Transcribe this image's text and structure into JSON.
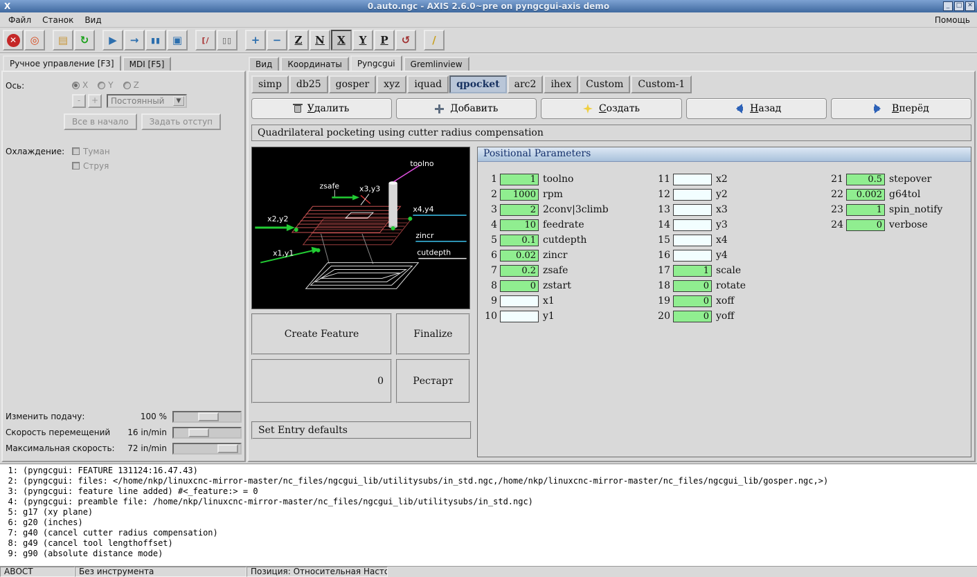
{
  "window": {
    "title": "0.auto.ngc - AXIS 2.6.0~pre on pyngcgui-axis demo",
    "logo_glyph": "X",
    "controls": [
      {
        "id": "minimize",
        "glyph": "_"
      },
      {
        "id": "maximize",
        "glyph": "□"
      },
      {
        "id": "close",
        "glyph": "✕"
      }
    ]
  },
  "menubar": {
    "items": [
      {
        "id": "file",
        "label": "Файл"
      },
      {
        "id": "machine",
        "label": "Станок"
      },
      {
        "id": "view",
        "label": "Вид"
      }
    ],
    "help": "Помощь"
  },
  "toolbar": {
    "icons": [
      {
        "id": "estop",
        "glyph": "✕",
        "color": "#ffffff",
        "circle": "#c42727"
      },
      {
        "id": "machine-power",
        "glyph": "◎",
        "color": "#d84a1e"
      },
      {
        "sep": true
      },
      {
        "id": "open-file",
        "glyph": "▤",
        "color": "#c8973a"
      },
      {
        "id": "reload-file",
        "glyph": "↻",
        "color": "#18a018"
      },
      {
        "sep": true
      },
      {
        "id": "run-program",
        "glyph": "▶",
        "color": "#2d6fae"
      },
      {
        "id": "step-line",
        "glyph": "→",
        "color": "#2d6fae"
      },
      {
        "id": "pause-program",
        "glyph": "▮▮",
        "color": "#2d6fae",
        "small": true
      },
      {
        "id": "stop-program",
        "glyph": "▣",
        "color": "#2d6fae"
      },
      {
        "sep": true
      },
      {
        "id": "skip-lines",
        "glyph": "[/",
        "color": "#a83232",
        "small": true
      },
      {
        "id": "optional-pause",
        "glyph": "▯▯",
        "color": "#555555",
        "small": true
      },
      {
        "sep": true
      },
      {
        "id": "zoom-in",
        "glyph": "+",
        "color": "#2d6fae"
      },
      {
        "id": "zoom-out",
        "glyph": "−",
        "color": "#2d6fae"
      },
      {
        "id": "view-top",
        "glyph": "Z",
        "color": "#1a1a1a",
        "underline": true
      },
      {
        "id": "view-top-rotated",
        "glyph": "N",
        "color": "#1a1a1a",
        "underline": true
      },
      {
        "id": "view-side",
        "glyph": "X",
        "color": "#1a1a1a",
        "underline": true,
        "pressed": true
      },
      {
        "id": "view-front",
        "glyph": "Y",
        "color": "#1a1a1a",
        "underline": true
      },
      {
        "id": "view-perspective",
        "glyph": "P",
        "color": "#1a1a1a",
        "underline": true
      },
      {
        "id": "rotate-view",
        "glyph": "↺",
        "color": "#a03030"
      },
      {
        "sep": true
      },
      {
        "id": "clear-plot",
        "glyph": "/",
        "color": "#c8a020"
      }
    ]
  },
  "left_panel": {
    "tabs": [
      {
        "id": "manual",
        "label": "Ручное управление [F3]",
        "active": true
      },
      {
        "id": "mdi",
        "label": "MDI [F5]",
        "active": false
      }
    ],
    "axis_label": "Ось:",
    "axis_options": [
      {
        "id": "x",
        "label": "X",
        "selected": true
      },
      {
        "id": "y",
        "label": "Y",
        "selected": false
      },
      {
        "id": "z",
        "label": "Z",
        "selected": false
      }
    ],
    "jog_minus": "-",
    "jog_plus": "+",
    "jog_mode": "Постоянный",
    "combo_arrow": "▼",
    "home_all": "Все в начало",
    "set_offset": "Задать отступ",
    "coolant_label": "Охлаждение:",
    "coolant_options": [
      {
        "id": "mist",
        "label": "Туман"
      },
      {
        "id": "flood",
        "label": "Струя"
      }
    ],
    "sliders": [
      {
        "id": "feed-override",
        "label": "Изменить подачу:",
        "value": "100 %",
        "pos": 36
      },
      {
        "id": "jog-speed",
        "label": "Скорость перемещений",
        "value": "16 in/min",
        "pos": 22
      },
      {
        "id": "max-velocity",
        "label": "Максимальная скорость:",
        "value": "72 in/min",
        "pos": 66
      }
    ]
  },
  "right_panel": {
    "tabs": [
      {
        "id": "preview",
        "label": "Вид",
        "active": false
      },
      {
        "id": "dro",
        "label": "Координаты",
        "active": false
      },
      {
        "id": "pyngcgui",
        "label": "Pyngcgui",
        "active": true
      },
      {
        "id": "gremlinview",
        "label": "Gremlinview",
        "active": false
      }
    ],
    "subtabs": [
      {
        "label": "simp"
      },
      {
        "label": "db25"
      },
      {
        "label": "gosper"
      },
      {
        "label": "xyz"
      },
      {
        "label": "iquad"
      },
      {
        "label": "qpocket",
        "active": true
      },
      {
        "label": "arc2"
      },
      {
        "label": "ihex"
      },
      {
        "label": "Custom"
      },
      {
        "label": "Custom-1"
      }
    ],
    "actions": [
      {
        "id": "delete",
        "label": "Удалить",
        "icon": "trash"
      },
      {
        "id": "add",
        "label": "Добавить",
        "icon": "plus"
      },
      {
        "id": "create",
        "label": "Создать",
        "icon": "new"
      },
      {
        "id": "back",
        "label": "Назад",
        "icon": "arrow-left"
      },
      {
        "id": "forward",
        "label": "Вперёд",
        "icon": "arrow-right"
      }
    ],
    "description": "Quadrilateral pocketing using cutter radius compensation",
    "preview": {
      "labels": {
        "toolno": "toolno",
        "zsafe": "zsafe",
        "x3y3": "x3,y3",
        "x4y4": "x4,y4",
        "x2y2": "x2,y2",
        "zincr": "zincr",
        "x1y1": "x1,y1",
        "cutdepth": "cutdepth"
      }
    },
    "feature_buttons": {
      "create": "Create Feature",
      "finalize": "Finalize",
      "count": "0",
      "restart": "Рестарт",
      "set_defaults": "Set Entry defaults"
    },
    "params": {
      "title": "Positional Parameters",
      "items": [
        {
          "num": "1",
          "value": "1",
          "label": "toolno",
          "filled": true
        },
        {
          "num": "2",
          "value": "1000",
          "label": "rpm",
          "filled": true
        },
        {
          "num": "3",
          "value": "2",
          "label": "2conv|3climb",
          "filled": true
        },
        {
          "num": "4",
          "value": "10",
          "label": "feedrate",
          "filled": true
        },
        {
          "num": "5",
          "value": "0.1",
          "label": "cutdepth",
          "filled": true
        },
        {
          "num": "6",
          "value": "0.02",
          "label": "zincr",
          "filled": true
        },
        {
          "num": "7",
          "value": "0.2",
          "label": "zsafe",
          "filled": true
        },
        {
          "num": "8",
          "value": "0",
          "label": "zstart",
          "filled": true
        },
        {
          "num": "9",
          "value": "",
          "label": "x1",
          "filled": false
        },
        {
          "num": "10",
          "value": "",
          "label": "y1",
          "filled": false
        },
        {
          "num": "11",
          "value": "",
          "label": "x2",
          "filled": false
        },
        {
          "num": "12",
          "value": "",
          "label": "y2",
          "filled": false
        },
        {
          "num": "13",
          "value": "",
          "label": "x3",
          "filled": false
        },
        {
          "num": "14",
          "value": "",
          "label": "y3",
          "filled": false
        },
        {
          "num": "15",
          "value": "",
          "label": "x4",
          "filled": false
        },
        {
          "num": "16",
          "value": "",
          "label": "y4",
          "filled": false
        },
        {
          "num": "17",
          "value": "1",
          "label": "scale",
          "filled": true
        },
        {
          "num": "18",
          "value": "0",
          "label": "rotate",
          "filled": true
        },
        {
          "num": "19",
          "value": "0",
          "label": "xoff",
          "filled": true
        },
        {
          "num": "20",
          "value": "0",
          "label": "yoff",
          "filled": true
        },
        {
          "num": "21",
          "value": "0.5",
          "label": "stepover",
          "filled": true
        },
        {
          "num": "22",
          "value": "0.002",
          "label": "g64tol",
          "filled": true
        },
        {
          "num": "23",
          "value": "1",
          "label": "spin_notify",
          "filled": true
        },
        {
          "num": "24",
          "value": "0",
          "label": "verbose",
          "filled": true
        }
      ]
    }
  },
  "terminal": {
    "lines": [
      {
        "num": "1:",
        "text": "(pyngcgui: FEATURE 131124:16.47.43)"
      },
      {
        "num": "2:",
        "text": "(pyngcgui: files: </home/nkp/linuxcnc-mirror-master/nc_files/ngcgui_lib/utilitysubs/in_std.ngc,/home/nkp/linuxcnc-mirror-master/nc_files/ngcgui_lib/gosper.ngc,>)"
      },
      {
        "num": "3:",
        "text": "(pyngcgui: feature line added) #<_feature:> = 0"
      },
      {
        "num": "4:",
        "text": "(pyngcgui: preamble file: /home/nkp/linuxcnc-mirror-master/nc_files/ngcgui_lib/utilitysubs/in_std.ngc)"
      },
      {
        "num": "5:",
        "text": "g17 (xy plane)"
      },
      {
        "num": "6:",
        "text": "g20 (inches)"
      },
      {
        "num": "7:",
        "text": "g40 (cancel cutter radius compensation)"
      },
      {
        "num": "8:",
        "text": "g49 (cancel tool lengthoffset)"
      },
      {
        "num": "9:",
        "text": "g90 (absolute distance mode)"
      }
    ]
  },
  "statusbar": {
    "estop": "АВОСТ",
    "tool": "Без инструмента",
    "position": "Позиция: Относительная Насто"
  }
}
